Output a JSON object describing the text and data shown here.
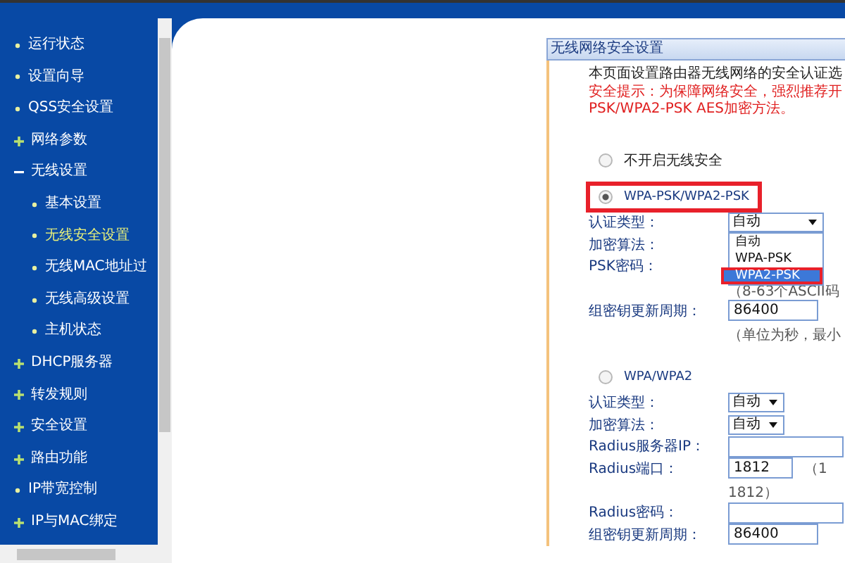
{
  "sidebar": {
    "items": [
      {
        "label": "运行状态",
        "kind": "link",
        "selected": false
      },
      {
        "label": "设置向导",
        "kind": "link",
        "selected": false
      },
      {
        "label": "QSS安全设置",
        "kind": "link",
        "selected": false
      },
      {
        "label": "网络参数",
        "kind": "group",
        "expanded": false,
        "selected": false
      },
      {
        "label": "无线设置",
        "kind": "group",
        "expanded": true,
        "selected": false,
        "children": [
          {
            "label": "基本设置",
            "selected": false
          },
          {
            "label": "无线安全设置",
            "selected": true
          },
          {
            "label": "无线MAC地址过",
            "selected": false
          },
          {
            "label": "无线高级设置",
            "selected": false
          },
          {
            "label": "主机状态",
            "selected": false
          }
        ]
      },
      {
        "label": "DHCP服务器",
        "kind": "group",
        "expanded": false,
        "selected": false
      },
      {
        "label": "转发规则",
        "kind": "group",
        "expanded": false,
        "selected": false
      },
      {
        "label": "安全设置",
        "kind": "group",
        "expanded": false,
        "selected": false
      },
      {
        "label": "路由功能",
        "kind": "group",
        "expanded": false,
        "selected": false
      },
      {
        "label": "IP带宽控制",
        "kind": "link",
        "selected": false
      },
      {
        "label": "IP与MAC绑定",
        "kind": "group",
        "expanded": false,
        "selected": false
      }
    ]
  },
  "panel": {
    "title": "无线网络安全设置",
    "intro": "本页面设置路由器无线网络的安全认证选",
    "warning_lines": [
      "安全提示：为保障网络安全，强烈推荐开",
      "PSK/WPA2-PSK AES加密方法。"
    ],
    "modes": [
      {
        "label": "不开启无线安全",
        "selected": false,
        "highlighted": false
      },
      {
        "label": "WPA-PSK/WPA2-PSK",
        "selected": true,
        "highlighted": true,
        "fields": [
          {
            "kind": "select",
            "label": "认证类型：",
            "value": "自动",
            "open": true,
            "options": [
              {
                "label": "自动",
                "highlighted": false
              },
              {
                "label": "WPA-PSK",
                "highlighted": false
              },
              {
                "label": "WPA2-PSK",
                "highlighted": true
              }
            ]
          },
          {
            "kind": "plain",
            "label": "加密算法："
          },
          {
            "kind": "plain",
            "label": "PSK密码："
          },
          {
            "kind": "note",
            "label": "（8-63个ASCII码"
          },
          {
            "kind": "input",
            "label": "组密钥更新周期：",
            "value": "86400"
          },
          {
            "kind": "note",
            "label": "（单位为秒，最小"
          }
        ]
      },
      {
        "label": "WPA/WPA2",
        "selected": false,
        "highlighted": false,
        "fields": [
          {
            "kind": "select",
            "label": "认证类型：",
            "value": "自动",
            "open": false
          },
          {
            "kind": "select",
            "label": "加密算法：",
            "value": "自动",
            "open": false
          },
          {
            "kind": "input",
            "label": "Radius服务器IP："
          },
          {
            "kind": "input",
            "label": "Radius端口：",
            "value": "1812",
            "side": "（1"
          },
          {
            "kind": "note",
            "label": "1812）"
          },
          {
            "kind": "input",
            "label": "Radius密码："
          },
          {
            "kind": "input",
            "label": "组密钥更新周期：",
            "value": "86400"
          }
        ]
      }
    ]
  }
}
